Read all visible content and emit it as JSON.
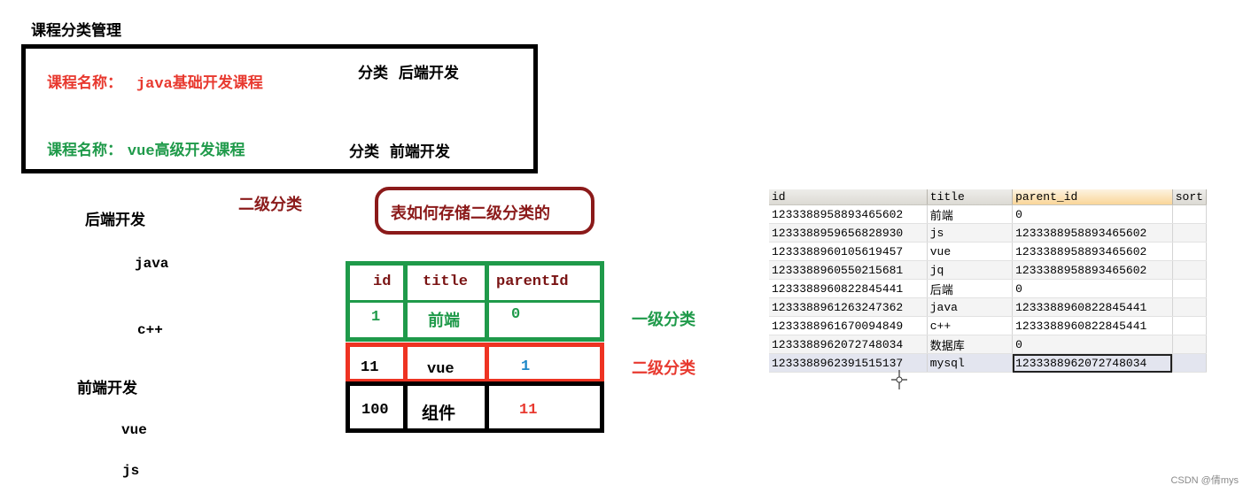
{
  "page_title": "课程分类管理",
  "courses": [
    {
      "label": "课程名称：",
      "name": "java基础开发课程",
      "category_label": "分类",
      "category": "后端开发",
      "color": "#e8392f"
    },
    {
      "label": "课程名称：",
      "name": "vue高级开发课程",
      "category_label": "分类",
      "category": "前端开发",
      "color": "#1f9a4a"
    }
  ],
  "tree": [
    {
      "parent": "后端开发",
      "children": [
        "java",
        "c++"
      ]
    },
    {
      "parent": "前端开发",
      "children": [
        "vue",
        "js"
      ]
    }
  ],
  "labels": {
    "level2_top": "二级分类",
    "callout": "表如何存储二级分类的",
    "level1": "一级分类",
    "level2_side": "二级分类"
  },
  "schema_table": {
    "columns": [
      "id",
      "title",
      "parentId"
    ],
    "rows": [
      {
        "level": "level1",
        "id": "1",
        "title": "前端",
        "parentId": "0",
        "color": "#1f9a4a",
        "parent_color": "#1f9a4a"
      },
      {
        "level": "level2",
        "id": "11",
        "title": "vue",
        "parentId": "1",
        "color": "#000000",
        "parent_color": "#1e88c8"
      },
      {
        "level": "level3",
        "id": "100",
        "title": "组件",
        "parentId": "11",
        "color": "#000000",
        "parent_color": "#e8392f"
      }
    ]
  },
  "db_grid": {
    "columns": [
      "id",
      "title",
      "parent_id",
      "sort"
    ],
    "sorted_column": "parent_id",
    "rows": [
      {
        "id": "1233388958893465602",
        "title": "前端",
        "parent_id": "0",
        "sort": ""
      },
      {
        "id": "1233388959656828930",
        "title": "js",
        "parent_id": "1233388958893465602",
        "sort": ""
      },
      {
        "id": "1233388960105619457",
        "title": "vue",
        "parent_id": "1233388958893465602",
        "sort": ""
      },
      {
        "id": "1233388960550215681",
        "title": "jq",
        "parent_id": "1233388958893465602",
        "sort": ""
      },
      {
        "id": "1233388960822845441",
        "title": "后端",
        "parent_id": "0",
        "sort": ""
      },
      {
        "id": "1233388961263247362",
        "title": "java",
        "parent_id": "1233388960822845441",
        "sort": ""
      },
      {
        "id": "1233388961670094849",
        "title": "c++",
        "parent_id": "1233388960822845441",
        "sort": ""
      },
      {
        "id": "1233388962072748034",
        "title": "数据库",
        "parent_id": "0",
        "sort": ""
      },
      {
        "id": "1233388962391515137",
        "title": "mysql",
        "parent_id": "1233388962072748034",
        "sort": ""
      }
    ],
    "selected_row": 8
  },
  "watermark": "CSDN @倩mys"
}
